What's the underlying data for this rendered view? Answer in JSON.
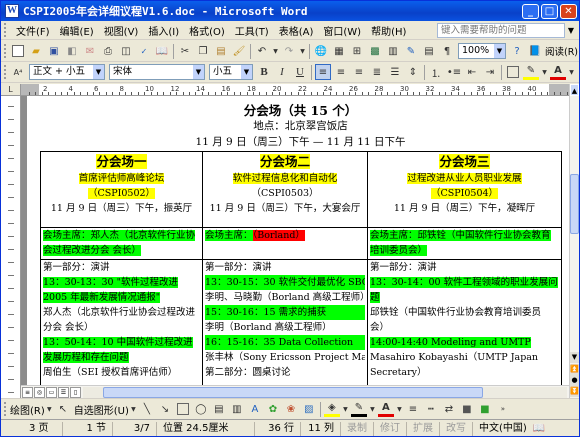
{
  "window": {
    "title": "CSPI2005年会详细议程V1.6.doc - Microsoft Word",
    "app_icon": "W"
  },
  "menubar": {
    "items": [
      "文件(F)",
      "编辑(E)",
      "视图(V)",
      "插入(I)",
      "格式(O)",
      "工具(T)",
      "表格(A)",
      "窗口(W)",
      "帮助(H)"
    ],
    "help_placeholder": "键入需要帮助的问题"
  },
  "toolbar1": {
    "zoom": "100%",
    "read_label": "阅读(R)"
  },
  "toolbar2": {
    "style": "正文 + 小五",
    "font": "宋体",
    "size": "小五",
    "bold": "B",
    "italic": "I",
    "underline": "U",
    "font_color_letter": "A"
  },
  "ruler": {
    "marks": [
      "2",
      "4",
      "6",
      "8",
      "10",
      "12",
      "14",
      "16",
      "18",
      "20",
      "22",
      "24",
      "26",
      "28",
      "30",
      "32",
      "34",
      "36",
      "38",
      "40"
    ]
  },
  "document": {
    "heading": "分会场（共 15 个）",
    "location": "地点：北京翠宫饭店",
    "dates": "11 月 9 日（周三）下午 — 11 月 11 日下午",
    "venues": [
      {
        "name": "分会场一",
        "topic": "首席评估师高峰论坛",
        "code": "（CSPI0502）",
        "time_place": "11 月 9 日（周三）下午，振英厅",
        "chair": "会场主席：郑人杰（北京软件行业协会过程改进分会 会长）",
        "part_label": "第一部分：演讲",
        "session1": "13：30-13：30 \"软件过程改进 2005 年最新发展情况通报\"",
        "speaker1": "郑人杰（北京软件行业协会过程改进分会 会长）",
        "session2": "13：50-14：10 中国软件过程改进发展历程和存在问题",
        "speaker2": "周伯生（SEI 授权首席评估师）"
      },
      {
        "name": "分会场二",
        "topic": "软件过程信息化和自动化",
        "code": "（CSPI0503）",
        "time_place": "11 月 9 日（周三）下午，大宴会厅",
        "chair_prefix": "会场主席：",
        "chair_name": "（Borland）",
        "part_label": "第一部分：演讲",
        "session1": "13：30-15：30 软件交付最优化 SBO",
        "speaker1": "李明、马晓勤（Borland 高级工程师）",
        "session2": "15：30-16：15 需求的捕获",
        "speaker2": "李明（Borland 高级工程师）",
        "session3": "16：15-16：35 Data Collection",
        "speaker3": "张丰林（Sony Ericsson Project Manager）",
        "part2_label": "第二部分：圆桌讨论"
      },
      {
        "name": "分会场三",
        "topic": "过程改进从业人员职业发展",
        "code": "（CSPI0504）",
        "time_place": "11 月 9 日（周三）下午，凝晖厅",
        "chair": "会场主席：邱铁铨（中国软件行业协会教育培训委员会）",
        "part_label": "第一部分：演讲",
        "session1": "13：30-14：00 软件工程领域的职业发展问题",
        "speaker1": "邱铁铨（中国软件行业协会教育培训委员会）",
        "session2": "14:00-14:40 Modeling and UMTP",
        "speaker2": "Masahiro Kobayashi（UMTP Japan Secretary）"
      }
    ]
  },
  "drawbar": {
    "draw_label": "绘图(R)",
    "autoshape_label": "自选图形(U)"
  },
  "statusbar": {
    "page": "3 页",
    "section": "1 节",
    "page_of": "3/7",
    "position": "位置 24.5厘米",
    "line": "36 行",
    "column": "11 列",
    "rec": "录制",
    "trk": "修订",
    "ext": "扩展",
    "ovr": "改写",
    "language": "中文(中国)"
  },
  "colors": {
    "title_bar": "#0A5FEC",
    "highlight_yellow": "#FFFF00",
    "highlight_green": "#00FF00",
    "highlight_red": "#FF0000"
  }
}
